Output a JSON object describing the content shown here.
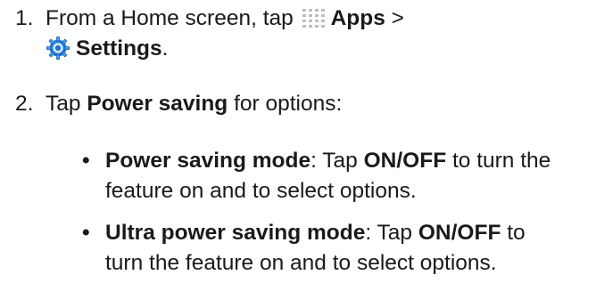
{
  "steps": [
    {
      "number": "1.",
      "text_before_apps": "From a Home screen, tap",
      "apps_label": "Apps",
      "separator": ">",
      "settings_label": "Settings",
      "end_punct": "."
    },
    {
      "number": "2.",
      "text_before": "Tap",
      "bold": "Power saving",
      "text_after": "for options:"
    }
  ],
  "bullets": [
    {
      "marker": "•",
      "title": "Power saving mode",
      "colon": ": Tap",
      "toggle": "ON/OFF",
      "rest_line1": "to turn the",
      "rest_line2": "feature on and to select options."
    },
    {
      "marker": "•",
      "title": "Ultra power saving mode",
      "colon": ": Tap",
      "toggle": "ON/OFF",
      "rest_line1": "to",
      "rest_line2": "turn the feature on and to select options."
    }
  ],
  "icons": {
    "apps": "apps-grid-icon",
    "settings": "settings-gear-icon",
    "apps_color": "#bdbdbd",
    "settings_color": "#1e88e5"
  }
}
